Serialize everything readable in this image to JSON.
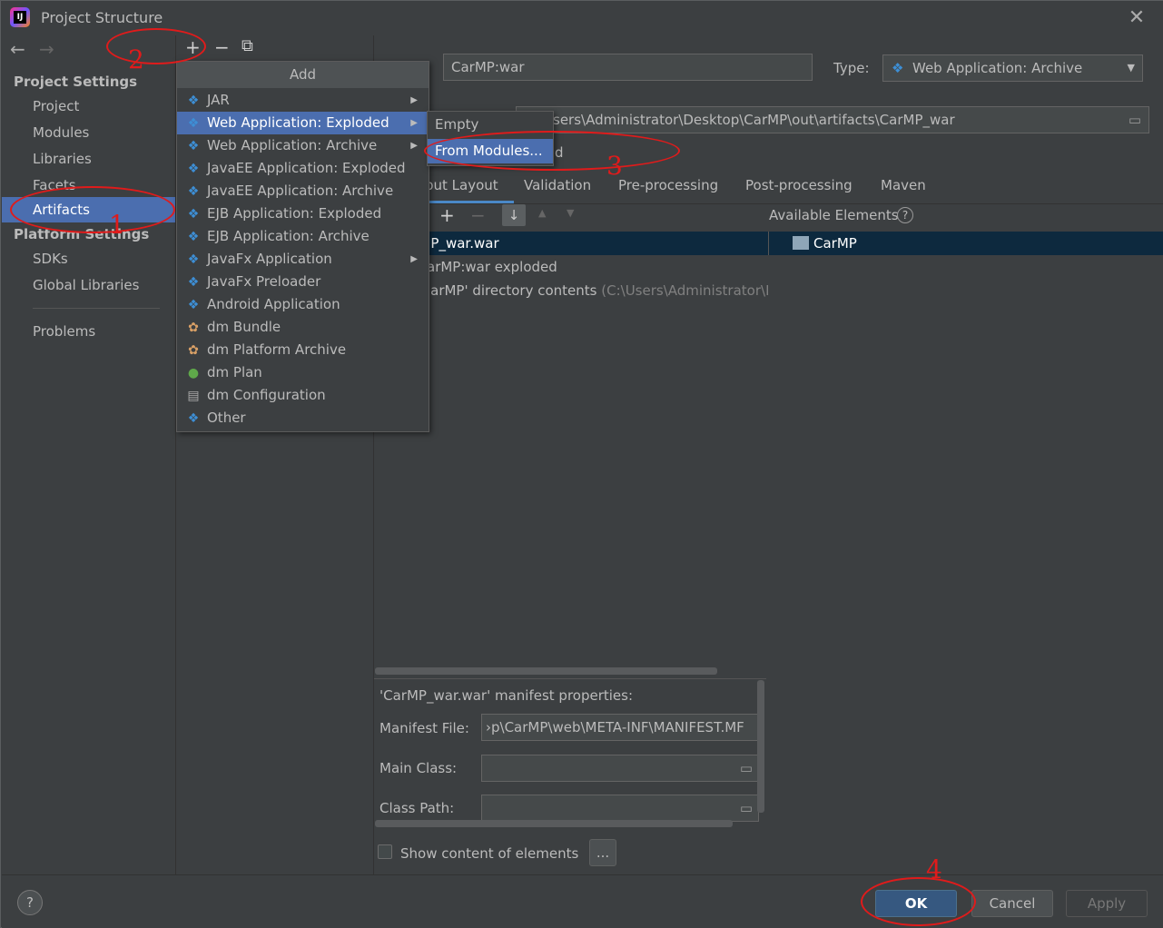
{
  "window": {
    "title": "Project Structure",
    "close_glyph": "✕"
  },
  "sidebar": {
    "back_glyph": "←",
    "forward_glyph": "→",
    "project_settings_heading": "Project Settings",
    "project_items": [
      "Project",
      "Modules",
      "Libraries",
      "Facets",
      "Artifacts"
    ],
    "selected_item": "Artifacts",
    "platform_settings_heading": "Platform Settings",
    "platform_items": [
      "SDKs",
      "Global Libraries"
    ],
    "problems_label": "Problems"
  },
  "toolbar": {
    "add_glyph": "+",
    "remove_glyph": "−",
    "copy_glyph": "⧉"
  },
  "artifact": {
    "name": "CarMP:war",
    "type_label": "Type:",
    "type_value": "Web Application: Archive",
    "output_dir": "sers\\Administrator\\Desktop\\CarMP\\out\\artifacts\\CarMP_war",
    "include_suffix": "d",
    "tabs": [
      "put Layout",
      "Validation",
      "Pre-processing",
      "Post-processing",
      "Maven"
    ],
    "available_elements_label": "Available Elements",
    "help_glyph": "?",
    "tree_rows": [
      "IP_war.war",
      "arMP:war exploded",
      "'arMP' directory contents"
    ],
    "tree_row_path": "(C:\\Users\\Administrator\\D",
    "available_root": "CarMP",
    "layout_add_glyph": "+",
    "layout_remove_glyph": "−",
    "sort_glyph": "↓",
    "up_glyph": "▲",
    "down_glyph": "▼"
  },
  "manifest": {
    "heading": "'CarMP_war.war' manifest properties:",
    "manifest_file_label": "Manifest File:",
    "manifest_file_value": "›p\\CarMP\\web\\META-INF\\MANIFEST.MF",
    "main_class_label": "Main Class:",
    "main_class_value": "",
    "class_path_label": "Class Path:",
    "class_path_value": ""
  },
  "show_content_label": "Show content of elements",
  "ellipsis_button": "...",
  "add_popup": {
    "title": "Add",
    "items": [
      {
        "label": "JAR",
        "icon": "diamond-icon",
        "submenu": true
      },
      {
        "label": "Web Application: Exploded",
        "icon": "web-app-icon",
        "submenu": true
      },
      {
        "label": "Web Application: Archive",
        "icon": "web-app-icon",
        "submenu": true
      },
      {
        "label": "JavaEE Application: Exploded",
        "icon": "javaee-icon",
        "submenu": false
      },
      {
        "label": "JavaEE Application: Archive",
        "icon": "javaee-icon",
        "submenu": false
      },
      {
        "label": "EJB Application: Exploded",
        "icon": "ejb-icon",
        "submenu": false
      },
      {
        "label": "EJB Application: Archive",
        "icon": "ejb-icon",
        "submenu": false
      },
      {
        "label": "JavaFx Application",
        "icon": "diamond-icon",
        "submenu": true
      },
      {
        "label": "JavaFx Preloader",
        "icon": "diamond-icon",
        "submenu": false
      },
      {
        "label": "Android Application",
        "icon": "diamond-icon",
        "submenu": false
      },
      {
        "label": "dm Bundle",
        "icon": "bundle-icon",
        "submenu": false
      },
      {
        "label": "dm Platform Archive",
        "icon": "bundle-icon",
        "submenu": false
      },
      {
        "label": "dm Plan",
        "icon": "globe-icon",
        "submenu": false
      },
      {
        "label": "dm Configuration",
        "icon": "document-icon",
        "submenu": false
      },
      {
        "label": "Other",
        "icon": "diamond-icon",
        "submenu": false
      }
    ],
    "selected_index": 1
  },
  "sub_popup": {
    "items": [
      "Empty",
      "From Modules..."
    ],
    "selected_index": 1
  },
  "buttons": {
    "help": "?",
    "ok": "OK",
    "cancel": "Cancel",
    "apply": "Apply"
  },
  "annotations": {
    "numbers": [
      "1",
      "2",
      "3",
      "4"
    ],
    "color": "#e01b1b"
  },
  "colors": {
    "background": "#3c3f41",
    "selection": "#4b6eaf",
    "primary_button": "#365880",
    "icon_blue": "#3d8fd6"
  }
}
